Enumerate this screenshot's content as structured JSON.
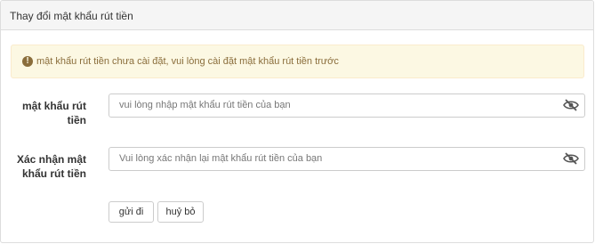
{
  "panel": {
    "title": "Thay đổi mật khẩu rút tiền"
  },
  "alert": {
    "icon": "exclamation-circle-icon",
    "message": "mật khẩu rút tiền chưa cài đặt, vui lòng cài đặt mật khẩu rút tiền trước"
  },
  "form": {
    "password": {
      "label_line1": "mật khẩu rút",
      "label_line2": "tiền",
      "placeholder": "vui lòng nhập mật khẩu rút tiền của bạn",
      "value": "",
      "icon": "eye-slash-icon"
    },
    "confirm": {
      "label_line1": "Xác nhận mật",
      "label_line2": "khẩu rút tiền",
      "placeholder": "Vui lòng xác nhận lại mật khẩu rút tiền của bạn",
      "value": "",
      "icon": "eye-slash-icon"
    },
    "submit_label": "gửi đi",
    "cancel_label": "huỷ bỏ"
  },
  "colors": {
    "alert_bg": "#fcf8e3",
    "alert_text": "#8a6d3b",
    "heading_bg": "#f5f5f5"
  }
}
